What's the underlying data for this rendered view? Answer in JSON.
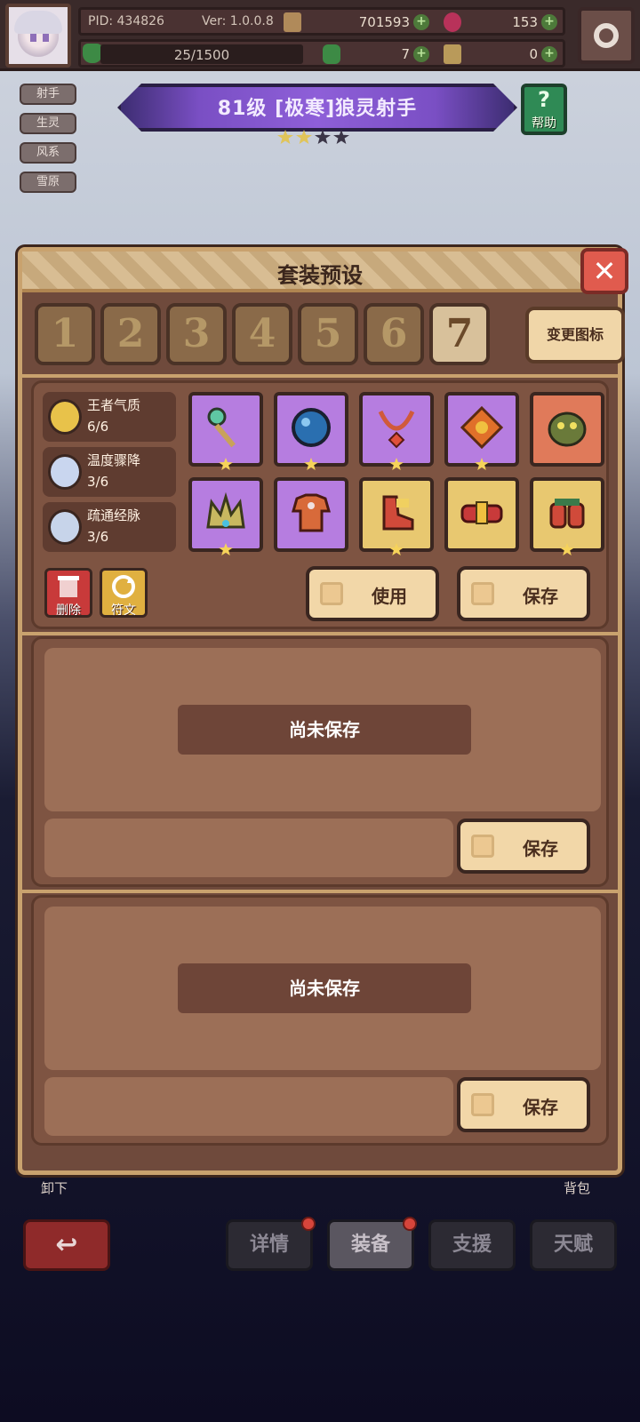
{
  "topbar": {
    "pid": "PID: 434826",
    "version": "Ver: 1.0.0.8",
    "gold": "701593",
    "gems": "153",
    "xp": "25/1500",
    "clover": "7",
    "hammer": "0"
  },
  "tags": [
    "射手",
    "生灵",
    "风系",
    "雪原"
  ],
  "hero": {
    "title": "81级 [极寒]狼灵射手",
    "stars_filled": 2,
    "stars_total": 4
  },
  "help": {
    "label": "帮助",
    "symbol": "?"
  },
  "modal": {
    "title": "套装预设",
    "close_symbol": "✕",
    "slots": [
      "1",
      "2",
      "3",
      "4",
      "5",
      "6",
      "7"
    ],
    "active_slot": "7",
    "change_icon_label": "变更图标",
    "sets": [
      {
        "name": "王者气质",
        "count": "6/6",
        "color": "#e8c24a"
      },
      {
        "name": "温度骤降",
        "count": "3/6",
        "color": "#c9d6ef"
      },
      {
        "name": "疏通经脉",
        "count": "3/6",
        "color": "#c7d4ea"
      }
    ],
    "equipment": [
      {
        "icon": "staff-icon",
        "rarity": "purple",
        "star": true
      },
      {
        "icon": "orb-icon",
        "rarity": "purple",
        "star": true
      },
      {
        "icon": "necklace-icon",
        "rarity": "purple",
        "star": true
      },
      {
        "icon": "amulet-icon",
        "rarity": "purple",
        "star": true
      },
      {
        "icon": "goblin-mask-icon",
        "rarity": "red",
        "star": false
      },
      {
        "icon": "crown-icon",
        "rarity": "purple",
        "star": true
      },
      {
        "icon": "armor-icon",
        "rarity": "purple",
        "star": false
      },
      {
        "icon": "boots-icon",
        "rarity": "gold",
        "star": true
      },
      {
        "icon": "belt-icon",
        "rarity": "gold",
        "star": false
      },
      {
        "icon": "gloves-icon",
        "rarity": "gold",
        "star": true
      }
    ],
    "delete_label": "删除",
    "rune_label": "符文",
    "use_label": "使用",
    "save_label": "保存",
    "empty_label": "尚未保存"
  },
  "under": {
    "unequip": "卸下",
    "bag": "背包"
  },
  "bottom_tabs": [
    {
      "label": "详情",
      "badge": true
    },
    {
      "label": "装备",
      "badge": true,
      "active": true
    },
    {
      "label": "支援",
      "badge": false
    },
    {
      "label": "天赋",
      "badge": false
    }
  ],
  "colors": {
    "accent": "#c9a26e",
    "panel": "#7e5442",
    "cream": "#f2d7a8"
  }
}
